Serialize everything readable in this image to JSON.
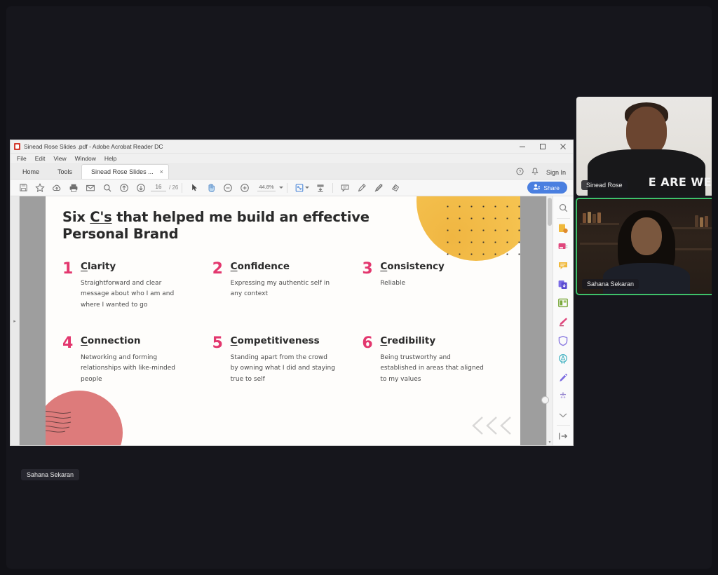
{
  "app": {
    "window_title": "Sinead Rose Slides .pdf - Adobe Acrobat Reader DC",
    "app_icon": "pdf-icon",
    "window_controls": {
      "minimize": "minimize-icon",
      "maximize": "maximize-icon",
      "close": "close-icon"
    },
    "menu": [
      "File",
      "Edit",
      "View",
      "Window",
      "Help"
    ],
    "tabs": [
      {
        "label": "Home",
        "active": false
      },
      {
        "label": "Tools",
        "active": false
      },
      {
        "label": "Sinead Rose Slides ...",
        "active": true,
        "close": "×"
      }
    ],
    "tab_right": {
      "help": "help-icon",
      "notifications": "bell-icon",
      "sign_in": "Sign In"
    }
  },
  "toolbar": {
    "icons": [
      "save-icon",
      "star-icon",
      "cloud-upload-icon",
      "print-icon",
      "email-icon",
      "search-icon",
      "previous-page-icon",
      "next-page-icon"
    ],
    "page_current": "16",
    "page_total": "/ 26",
    "select_tool": "cursor-icon",
    "hand_tool": "hand-icon",
    "zoom_out": "zoom-out-icon",
    "zoom_in": "zoom-in-icon",
    "zoom_value": "44.8%",
    "fit_page": "fit-page-icon",
    "scroll_mode": "scroll-mode-icon",
    "comment": "comment-icon",
    "highlight": "highlight-icon",
    "draw": "draw-icon",
    "stamp": "stamp-icon",
    "share_label": "Share",
    "share_icon": "share-person-icon",
    "share_color": "#4a7fe0"
  },
  "tool_panel": {
    "items": [
      {
        "name": "search-tool-icon",
        "color": "#8a8a8a"
      },
      {
        "name": "export-pdf-tool-icon",
        "color": "#e8a33d"
      },
      {
        "name": "create-pdf-tool-icon",
        "color": "#e0467c"
      },
      {
        "name": "comment-tool-icon",
        "color": "#f0b93c"
      },
      {
        "name": "combine-files-tool-icon",
        "color": "#6a6ae0"
      },
      {
        "name": "organize-pages-tool-icon",
        "color": "#7aa83c"
      },
      {
        "name": "fill-sign-tool-icon",
        "color": "#e0467c"
      },
      {
        "name": "protect-tool-icon",
        "color": "#8a7ae0"
      },
      {
        "name": "certificate-tool-icon",
        "color": "#4ab5c4"
      },
      {
        "name": "edit-pdf-tool-icon",
        "color": "#7a6ae0"
      },
      {
        "name": "compress-tool-icon",
        "color": "#9a8ad0"
      },
      {
        "name": "more-tools-chevron-icon",
        "color": "#9a9a9a"
      },
      {
        "name": "expand-panel-icon",
        "color": "#6a6a6a"
      }
    ]
  },
  "slide": {
    "title_prefix": "Six ",
    "title_underlined": "C's",
    "title_rest": " that helped me build an effective Personal Brand",
    "accent_number_color": "#e3376e",
    "blob_yellow_color": "#f3bf4c",
    "blob_red_color": "#dd7b7b",
    "items": [
      {
        "number": "1",
        "initial": "C",
        "term_rest": "larity",
        "desc": "Straightforward and clear message about who I am and where I wanted to go"
      },
      {
        "number": "2",
        "initial": "C",
        "term_rest": "onfidence",
        "desc": "Expressing my authentic self in any context"
      },
      {
        "number": "3",
        "initial": "C",
        "term_rest": "onsistency",
        "desc": "Reliable"
      },
      {
        "number": "4",
        "initial": "C",
        "term_rest": "onnection",
        "desc": "Networking and forming relationships with like-minded people"
      },
      {
        "number": "5",
        "initial": "C",
        "term_rest": "ompetitiveness",
        "desc": "Standing apart from the crowd by owning what I did and staying true to self"
      },
      {
        "number": "6",
        "initial": "C",
        "term_rest": "redibility",
        "desc": "Being trustworthy and established in areas that aligned to my values"
      }
    ]
  },
  "meeting": {
    "participants": [
      {
        "name": "Sinead Rose",
        "tshirt_text": "E ARE WE",
        "active_speaker": false
      },
      {
        "name": "Sahana Sekaran",
        "active_speaker": true
      }
    ],
    "self_label": "Sahana Sekaran",
    "active_speaker_color": "#3ec16a"
  }
}
